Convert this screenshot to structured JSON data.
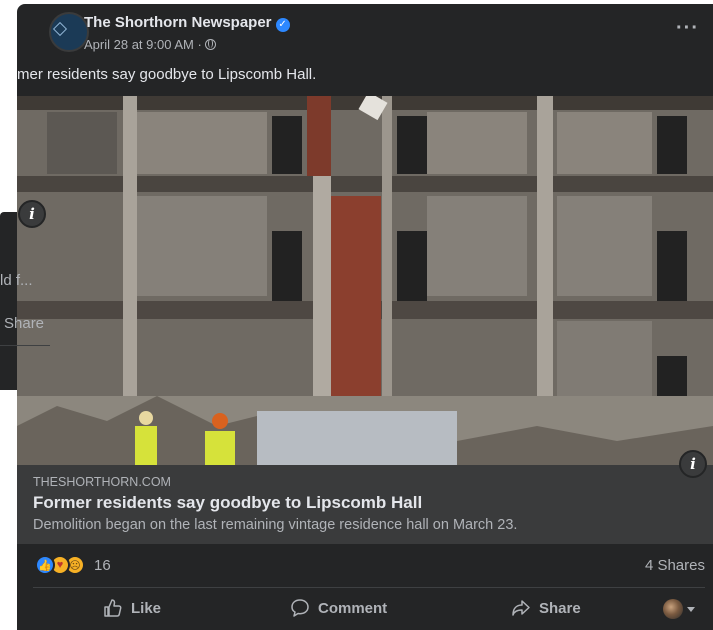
{
  "background_card": {
    "text_line1": "ld f...",
    "text_line2": "Share"
  },
  "post": {
    "page_name": "The Shorthorn Newspaper",
    "timestamp": "April 28 at 9:00 AM ·",
    "caption": "mer residents say goodbye to Lipscomb Hall.",
    "link": {
      "domain": "THESHORTHORN.COM",
      "title": "Former residents say goodbye to Lipscomb Hall",
      "description": "Demolition began on the last remaining vintage residence hall on March 23."
    },
    "reaction_count": "16",
    "shares": "4 Shares",
    "actions": {
      "like": "Like",
      "comment": "Comment",
      "share": "Share"
    },
    "icons": {
      "verified": "verified-badge-icon",
      "visibility": "globe-icon",
      "more": "more-options-icon",
      "info": "info-icon"
    },
    "colors": {
      "card_bg": "#242526",
      "link_bg": "#3a3b3c",
      "accent": "#2d88ff",
      "secondary_text": "#b0b3b8"
    }
  }
}
